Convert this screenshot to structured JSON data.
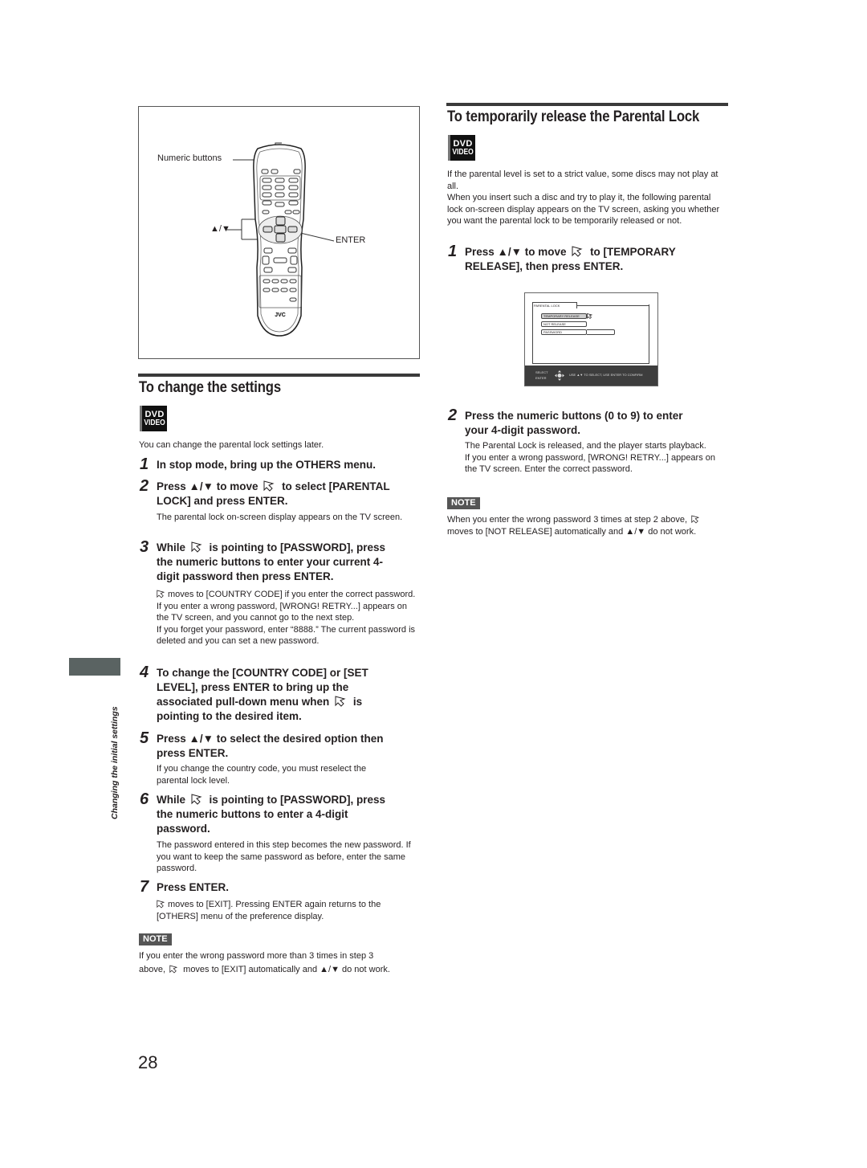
{
  "figure": {
    "label_numeric": "Numeric buttons",
    "label_updown": "▲/▼",
    "label_enter": "ENTER",
    "brand": "JVC"
  },
  "change_settings": {
    "title": "To change the settings",
    "badge": {
      "line1": "DVD",
      "line2": "VIDEO"
    },
    "intro": "You can change the parental lock settings later.",
    "steps": [
      {
        "num": "1",
        "text": "In stop mode, bring up the OTHERS menu."
      },
      {
        "num": "2",
        "text_a": "Press ▲/▼ to move",
        "text_b": "to select [PARENTAL",
        "text_c": "LOCK] and press ENTER.",
        "sub": "The parental lock on-screen display appears on the TV screen."
      },
      {
        "num": "3",
        "text_a": "While",
        "text_b": "is pointing to [PASSWORD], press",
        "text_c": "the numeric buttons to enter your current 4-",
        "text_d": "digit password then press ENTER.",
        "sub1": "moves to [COUNTRY CODE] if you enter the correct password.",
        "sub2": "If you enter a wrong password, [WRONG! RETRY...] appears on the TV screen, and you cannot go to the next step.",
        "sub3": "If you forget your password, enter “8888.” The current password is deleted and you can set a new password."
      },
      {
        "num": "4",
        "text_a": "To change the [COUNTRY CODE] or [SET",
        "text_b": "LEVEL], press ENTER to bring up the",
        "text_c": "associated pull-down menu when",
        "text_d": "is",
        "text_e": "pointing to the desired item."
      },
      {
        "num": "5",
        "text_a": "Press ▲/▼ to select the desired option then",
        "text_b": "press ENTER.",
        "sub": "If you change the country code, you must reselect the parental lock level."
      },
      {
        "num": "6",
        "text_a": "While",
        "text_b": "is pointing to [PASSWORD], press",
        "text_c": "the numeric buttons to enter a 4-digit",
        "text_d": "password.",
        "sub": "The password entered in this step becomes the new password. If you want to keep the same password as before, enter the same password."
      },
      {
        "num": "7",
        "text": "Press ENTER.",
        "sub": "moves to [EXIT]. Pressing ENTER again returns to the [OTHERS] menu of the preference display."
      }
    ],
    "note_label": "NOTE",
    "note_a": "If you enter the wrong password more than 3 times in step 3",
    "note_b": "above,",
    "note_c": "moves to [EXIT] automatically and ▲/▼ do not work."
  },
  "temp_release": {
    "title": "To temporarily release the Parental Lock",
    "badge": {
      "line1": "DVD",
      "line2": "VIDEO"
    },
    "intro1": "If the parental level is set to a strict value, some discs may not play at all.",
    "intro2": "When you insert such a disc and try to play it, the following parental lock on-screen display appears on the TV screen, asking you whether you want the parental lock to be temporarily released or not.",
    "step1": {
      "num": "1",
      "text_a": "Press ▲/▼ to move",
      "text_b": "to [TEMPORARY",
      "text_c": "RELEASE], then press ENTER."
    },
    "osd": {
      "tab": "PARENTAL LOCK",
      "items": [
        "TEMPORARY RELEASE",
        "NOT RELEASE",
        "PASSWORD"
      ],
      "selected": "TEMPORARY RELEASE",
      "bar_left1": "SELECT",
      "bar_left2": "ENTER",
      "bar_hint": "USE ▲▼ TO SELECT, USE ENTER TO CONFIRM"
    },
    "step2": {
      "num": "2",
      "text_a": "Press the numeric buttons (0 to 9) to enter",
      "text_b": "your 4-digit password.",
      "sub1": "The Parental Lock is released, and the player starts playback.",
      "sub2": "If you enter a wrong password, [WRONG! RETRY...] appears on the TV screen. Enter the correct password."
    },
    "note_label": "NOTE",
    "note_a": "When you enter the wrong password 3 times at step 2 above,",
    "note_b": "moves to [NOT RELEASE] automatically and ▲/▼ do not work."
  },
  "side_label": "Changing the initial settings",
  "page_number": "28"
}
